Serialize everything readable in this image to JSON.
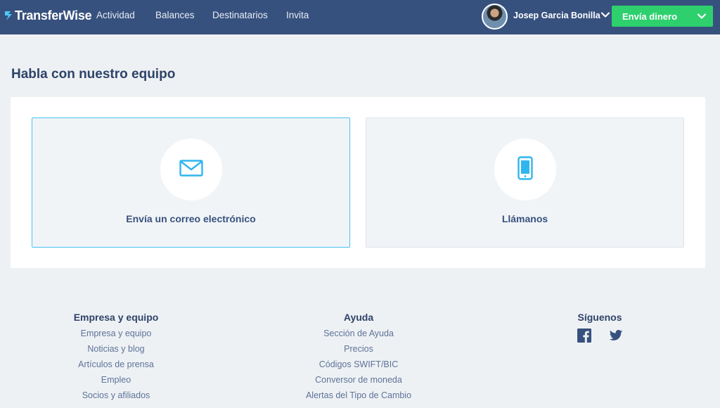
{
  "header": {
    "logo_text": "TransferWise",
    "nav": [
      {
        "label": "Actividad"
      },
      {
        "label": "Balances"
      },
      {
        "label": "Destinatarios"
      },
      {
        "label": "Invita"
      }
    ],
    "user_name": "Josep Garcia Bonilla",
    "send_button_label": "Envía dinero",
    "colors": {
      "bar": "#37517e",
      "send": "#2ed06e"
    }
  },
  "main": {
    "title": "Habla con nuestro equipo",
    "cards": [
      {
        "label": "Envía un correo electrónico",
        "icon": "envelope-icon"
      },
      {
        "label": "Llámanos",
        "icon": "phone-icon"
      }
    ],
    "accent": "#47c4f2"
  },
  "footer": {
    "columns": [
      {
        "heading": "Empresa y equipo",
        "links": [
          "Empresa y equipo",
          "Noticias y blog",
          "Artículos de prensa",
          "Empleo",
          "Socios y afiliados"
        ]
      },
      {
        "heading": "Ayuda",
        "links": [
          "Sección de Ayuda",
          "Precios",
          "Códigos SWIFT/BIC",
          "Conversor de moneda",
          "Alertas del Tipo de Cambio"
        ]
      },
      {
        "heading": "Síguenos",
        "social": [
          "facebook-icon",
          "twitter-icon"
        ]
      }
    ]
  }
}
